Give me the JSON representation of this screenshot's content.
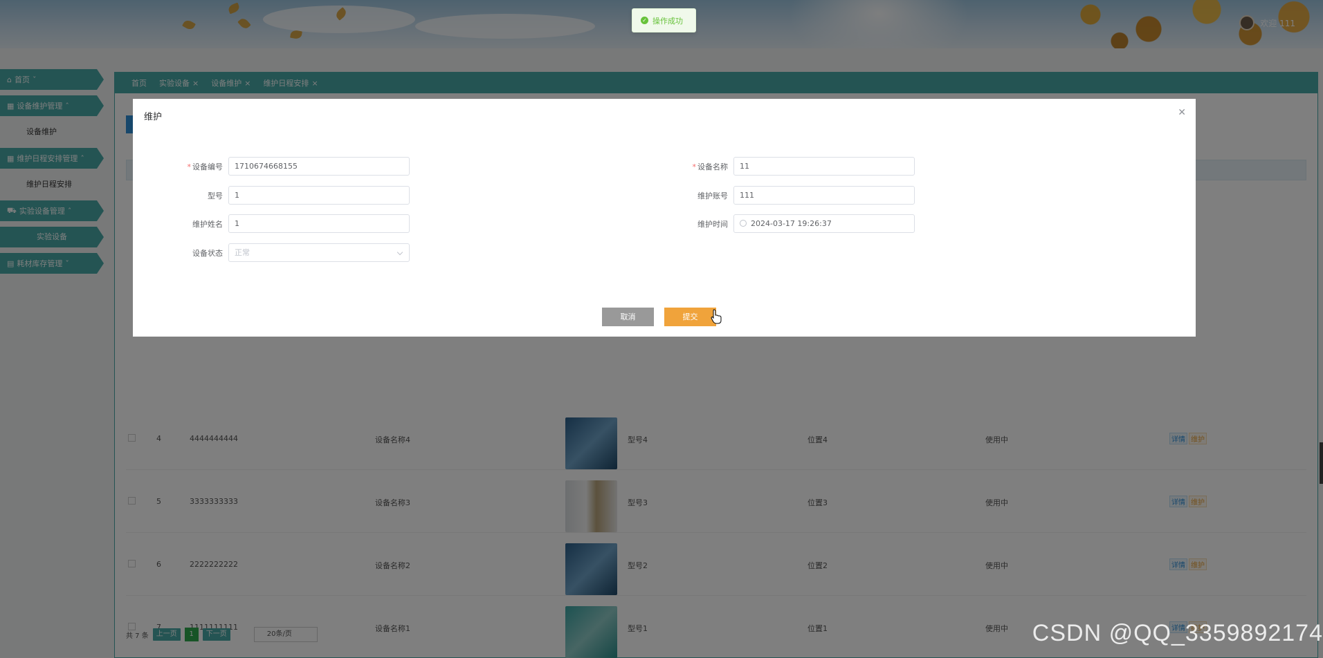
{
  "header": {
    "welcome": "欢迎 111"
  },
  "toast": {
    "message": "操作成功"
  },
  "sidebar": {
    "items": [
      {
        "label": "首页",
        "icon": "home-icon"
      },
      {
        "label": "设备维护管理",
        "icon": "grid-icon",
        "children": [
          "设备维护"
        ]
      },
      {
        "label": "维护日程安排管理",
        "icon": "grid-icon",
        "children": [
          "维护日程安排"
        ]
      },
      {
        "label": "实验设备管理",
        "icon": "truck-icon",
        "children": [
          "实验设备"
        ]
      },
      {
        "label": "耗材库存管理",
        "icon": "layers-icon"
      }
    ]
  },
  "tabs": [
    {
      "label": "首页"
    },
    {
      "label": "实验设备"
    },
    {
      "label": "设备维护"
    },
    {
      "label": "维护日程安排"
    }
  ],
  "table": {
    "rows": [
      {
        "index": "4",
        "code": "4444444444",
        "name": "设备名称4",
        "model": "型号4",
        "location": "位置4",
        "status": "使用中"
      },
      {
        "index": "5",
        "code": "3333333333",
        "name": "设备名称3",
        "model": "型号3",
        "location": "位置3",
        "status": "使用中"
      },
      {
        "index": "6",
        "code": "2222222222",
        "name": "设备名称2",
        "model": "型号2",
        "location": "位置2",
        "status": "使用中"
      },
      {
        "index": "7",
        "code": "1111111111",
        "name": "设备名称1",
        "model": "型号1",
        "location": "位置1",
        "status": "使用中"
      }
    ],
    "detail_label": "详情",
    "maintain_label": "维护"
  },
  "pager": {
    "total": "共 7 条",
    "prev": "上一页",
    "current": "1",
    "next": "下一页",
    "page_size": "20条/页"
  },
  "dialog": {
    "title": "维护",
    "fields": {
      "device_code": {
        "label": "设备编号",
        "value": "1710674668155"
      },
      "device_name": {
        "label": "设备名称",
        "value": "11"
      },
      "model": {
        "label": "型号",
        "value": "1"
      },
      "maint_account": {
        "label": "维护账号",
        "value": "111"
      },
      "maint_name": {
        "label": "维护姓名",
        "value": "1"
      },
      "maint_time": {
        "label": "维护时间",
        "value": "2024-03-17 19:26:37"
      },
      "device_status": {
        "label": "设备状态",
        "value": "正常"
      }
    },
    "cancel": "取消",
    "submit": "提交"
  },
  "watermark": "CSDN @QQ_3359892174",
  "colors": {
    "accent": "#48a9a6",
    "submit": "#f0a33b",
    "success": "#67c23a"
  }
}
